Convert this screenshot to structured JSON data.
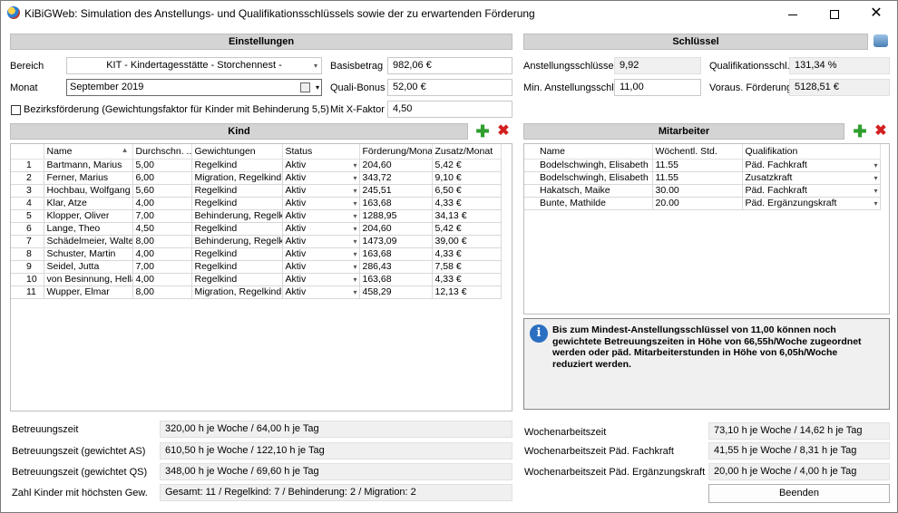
{
  "window": {
    "title": "KiBiGWeb: Simulation des Anstellungs- und Qualifikationsschlüssels sowie der zu erwartenden Förderung",
    "minimize": "",
    "maximize": "",
    "close": "✕"
  },
  "einstellungen": {
    "header": "Einstellungen",
    "bereich_label": "Bereich",
    "bereich_value": "KIT - Kindertagesstätte - Storchennest -",
    "monat_label": "Monat",
    "monat_value": "September 2019",
    "basisbetrag_label": "Basisbetrag",
    "basisbetrag_value": "982,06 €",
    "qualibonus_label": "Quali-Bonus",
    "qualibonus_value": "52,00 €",
    "bezirk_label": "Bezirksförderung (Gewichtungsfaktor für Kinder mit Behinderung 5,5)",
    "bezirk_checked": false,
    "xfaktor_label": "Mit X-Faktor",
    "xfaktor_value": "4,50"
  },
  "schluessel": {
    "header": "Schlüssel",
    "anstellung_label": "Anstellungsschlüssel",
    "anstellung_value": "9,92",
    "quali_label": "Qualifikationsschl.",
    "quali_value": "131,34 %",
    "min_label": "Min. Anstellungsschl.",
    "min_value": "11,00",
    "foerderung_label": "Voraus. Förderung",
    "foerderung_value": "5128,51 €"
  },
  "kind": {
    "header": "Kind",
    "add_icon": "✚",
    "delete_icon": "✖",
    "columns": [
      "Name",
      "Durchschn. ...",
      "Gewichtungen",
      "Status",
      "Förderung/Monat",
      "Zusatz/Monat"
    ],
    "sort_icon": "▲",
    "rows": [
      [
        "1",
        "Bartmann, Marius",
        "5,00",
        "Regelkind",
        "Aktiv",
        "204,60",
        "5,42 €"
      ],
      [
        "2",
        "Ferner, Marius",
        "6,00",
        "Migration, Regelkind",
        "Aktiv",
        "343,72",
        "9,10 €"
      ],
      [
        "3",
        "Hochbau, Wolfgang",
        "5,60",
        "Regelkind",
        "Aktiv",
        "245,51",
        "6,50 €"
      ],
      [
        "4",
        "Klar, Atze",
        "4,00",
        "Regelkind",
        "Aktiv",
        "163,68",
        "4,33 €"
      ],
      [
        "5",
        "Klopper, Oliver",
        "7,00",
        "Behinderung, Regelkind",
        "Aktiv",
        "1288,95",
        "34,13 €"
      ],
      [
        "6",
        "Lange, Theo",
        "4,50",
        "Regelkind",
        "Aktiv",
        "204,60",
        "5,42 €"
      ],
      [
        "7",
        "Schädelmeier, Walter",
        "8,00",
        "Behinderung, Regelkind",
        "Aktiv",
        "1473,09",
        "39,00 €"
      ],
      [
        "8",
        "Schuster, Martin",
        "4,00",
        "Regelkind",
        "Aktiv",
        "163,68",
        "4,33 €"
      ],
      [
        "9",
        "Seidel, Jutta",
        "7,00",
        "Regelkind",
        "Aktiv",
        "286,43",
        "7,58 €"
      ],
      [
        "10",
        "von Besinnung, Hella",
        "4,00",
        "Regelkind",
        "Aktiv",
        "163,68",
        "4,33 €"
      ],
      [
        "11",
        "Wupper, Elmar",
        "8,00",
        "Migration, Regelkind",
        "Aktiv",
        "458,29",
        "12,13 €"
      ]
    ]
  },
  "mitarbeiter": {
    "header": "Mitarbeiter",
    "add_icon": "✚",
    "delete_icon": "✖",
    "columns": [
      "Name",
      "Wöchentl. Std.",
      "Qualifikation"
    ],
    "rows": [
      [
        "Bodelschwingh, Elisabeth",
        "11.55",
        "Päd. Fachkraft"
      ],
      [
        "Bodelschwingh, Elisabeth",
        "11.55",
        "Zusatzkraft"
      ],
      [
        "Hakatsch, Maike",
        "30.00",
        "Päd. Fachkraft"
      ],
      [
        "Bunte, Mathilde",
        "20.00",
        "Päd. Ergänzungskraft"
      ]
    ]
  },
  "info": {
    "icon": "i",
    "text": "Bis zum Mindest-Anstellungsschlüssel von 11,00 können noch gewichtete Betreuungszeiten in Höhe von 66,55h/Woche zugeordnet werden oder päd. Mitarbeiterstunden in Höhe von 6,05h/Woche reduziert werden."
  },
  "summary_left": [
    {
      "label": "Betreuungszeit",
      "value": "320,00 h je Woche / 64,00 h je Tag"
    },
    {
      "label": "Betreuungszeit (gewichtet AS)",
      "value": "610,50 h je Woche / 122,10 h je Tag"
    },
    {
      "label": "Betreuungszeit (gewichtet QS)",
      "value": "348,00 h je Woche / 69,60 h je Tag"
    },
    {
      "label": "Zahl Kinder mit höchsten Gew.",
      "value": "Gesamt: 11 / Regelkind: 7 / Behinderung: 2 / Migration: 2"
    }
  ],
  "summary_right": [
    {
      "label": "Wochenarbeitszeit",
      "value": "73,10 h je Woche / 14,62 h je Tag"
    },
    {
      "label": "Wochenarbeitszeit Päd. Fachkraft",
      "value": "41,55 h je Woche / 8,31 h je Tag"
    },
    {
      "label": "Wochenarbeitszeit Päd. Ergänzungskraft",
      "value": "20,00 h je Woche / 4,00 h je Tag"
    }
  ],
  "beenden_label": "Beenden"
}
